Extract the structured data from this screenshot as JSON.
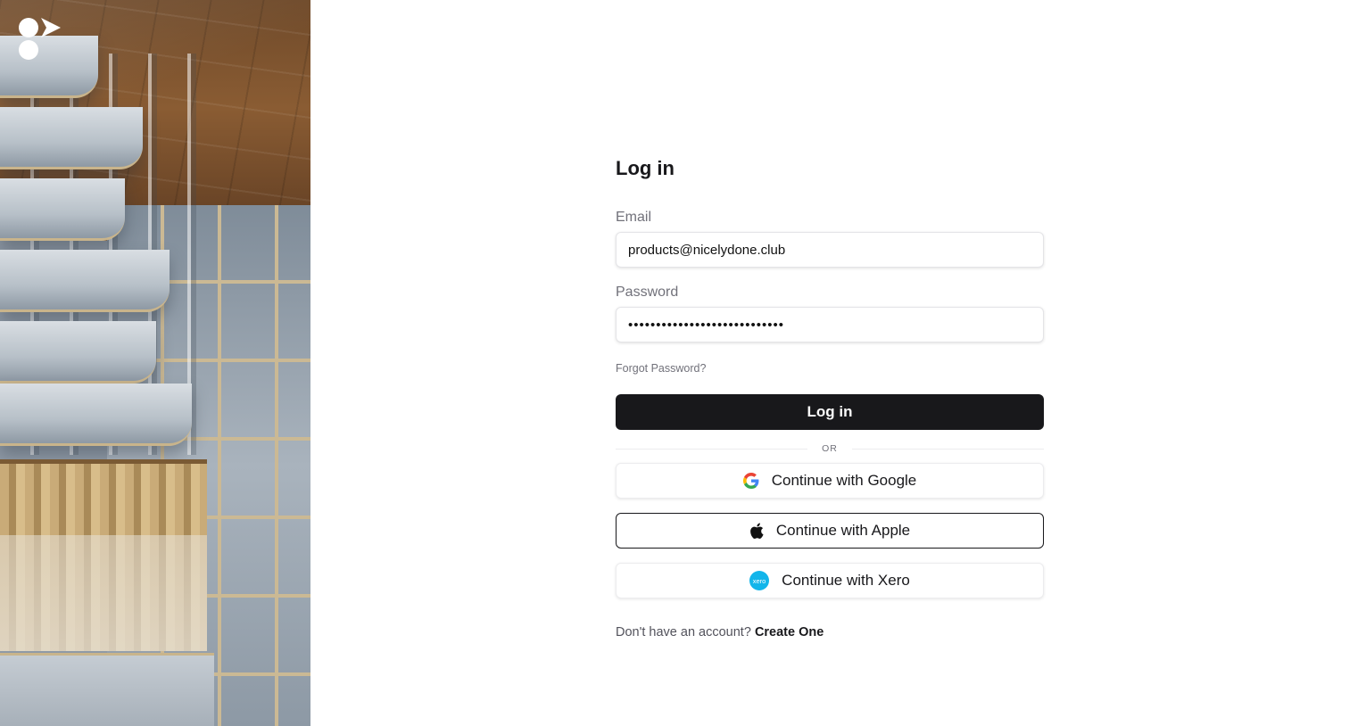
{
  "hero": {
    "image_alt": "Architectural building facade"
  },
  "brand": {
    "logo_icon": "brand-logo-icon"
  },
  "login": {
    "title": "Log in",
    "email_label": "Email",
    "email_value": "products@nicelydone.club",
    "password_label": "Password",
    "password_value": "••••••••••••••••••••••••••••",
    "forgot_password": "Forgot Password?",
    "submit_label": "Log in",
    "divider_text": "OR",
    "google_label": "Continue with Google",
    "apple_label": "Continue with Apple",
    "xero_label": "Continue with Xero",
    "signup_prompt": "Don't have an account?",
    "signup_link": "Create One"
  },
  "colors": {
    "primary_button": "#18181b",
    "muted_text": "#71717a",
    "xero_blue": "#13b5ea"
  }
}
